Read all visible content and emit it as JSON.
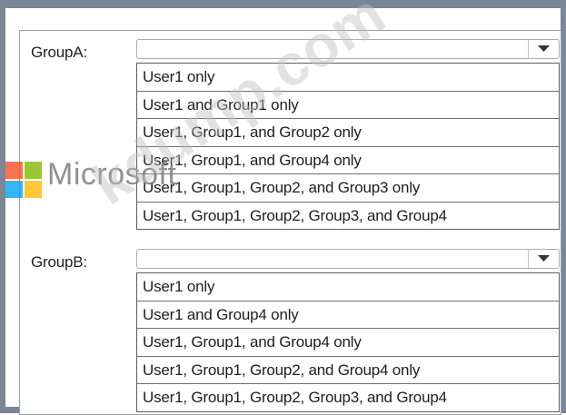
{
  "groupA": {
    "label": "GroupA:",
    "selected": "",
    "arrow_icon": "chevron-down-icon",
    "options": [
      "User1 only",
      "User1 and Group1 only",
      "User1, Group1, and Group2 only",
      "User1, Group1, and Group4 only",
      "User1, Group1, Group2, and Group3 only",
      "User1, Group1, Group2, Group3, and Group4"
    ]
  },
  "groupB": {
    "label": "GroupB:",
    "selected": "",
    "arrow_icon": "chevron-down-icon",
    "options": [
      "User1 only",
      "User1 and Group4 only",
      "User1, Group1, and Group4 only",
      "User1, Group1, Group2, and Group4 only",
      "User1, Group1, Group2, Group3, and Group4"
    ]
  },
  "overlay": {
    "brand_text": "Microsoft",
    "watermark_text": "kdump.com",
    "logo_colors": [
      "#f25022",
      "#7fba00",
      "#00a4ef",
      "#ffb900"
    ]
  }
}
